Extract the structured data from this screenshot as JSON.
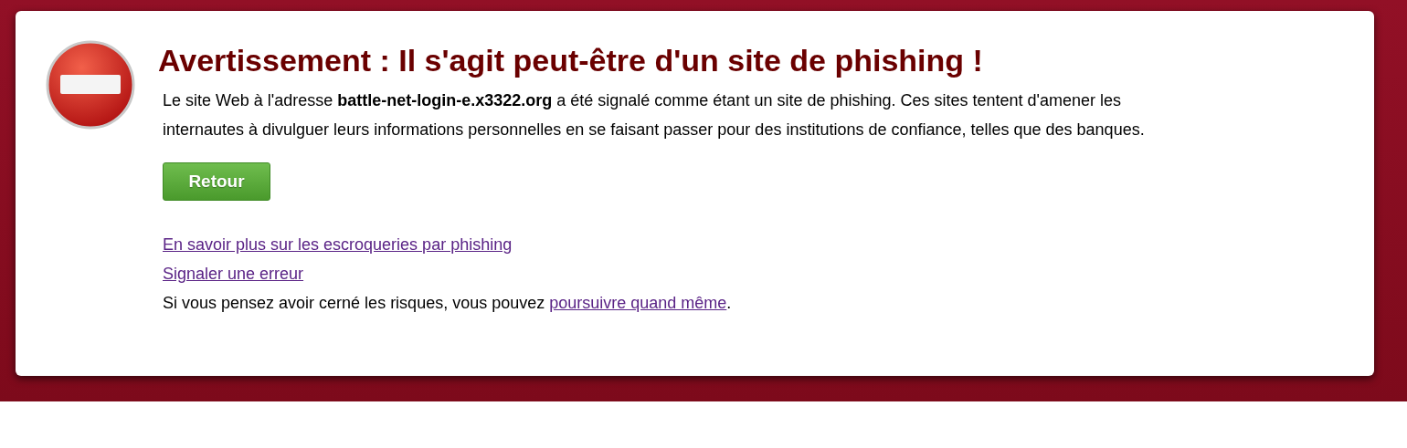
{
  "title": "Avertissement : Il s'agit peut-être d'un site de phishing !",
  "message": "Le site Web à l'adresse **battle-net-login-e.x3322.org** a été signalé comme étant un site de phishing. Ces sites tentent d'amener les internautes à divulguer leurs informations personnelles en se faisant passer pour des institutions de confiance, telles que des banques.",
  "back_button": "Retour",
  "links": [
    {
      "label": "En savoir plus sur les escroqueries par phishing"
    },
    {
      "label": "Signaler une erreur"
    }
  ],
  "proceed": {
    "before": "Si vous pensez avoir cerné les risques, vous pouvez ",
    "link": "poursuivre quand même",
    "after": "."
  }
}
